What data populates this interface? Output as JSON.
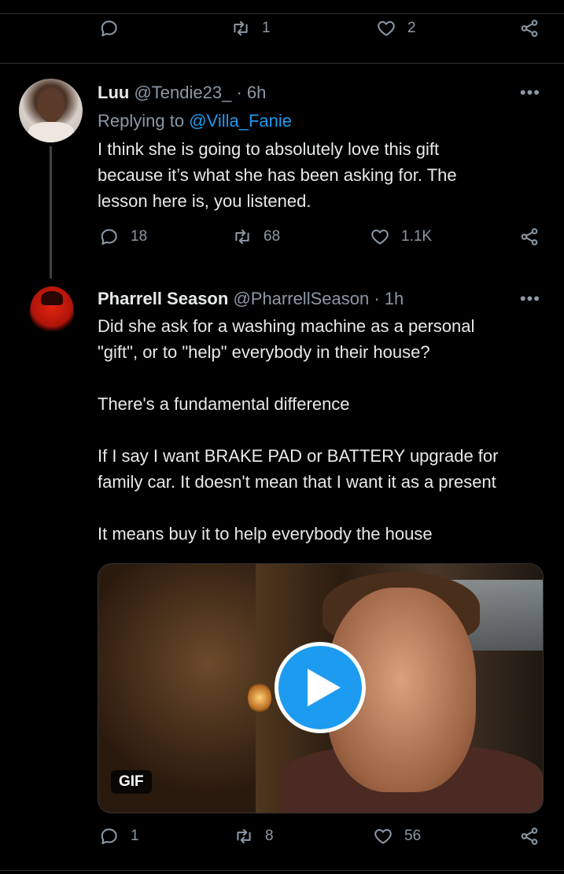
{
  "prev_tweet": {
    "reply_count": "",
    "retweet_count": "1",
    "like_count": "2"
  },
  "tweet1": {
    "name": "Luu",
    "handle": "@Tendie23_",
    "time": "· 6h",
    "replying_prefix": "Replying to",
    "replying_to": "@Villa_Fanie",
    "text": "I think she is going to absolutely love this gift\nbecause it’s what she has been asking for. The\nlesson here is, you listened.",
    "reply_count": "18",
    "retweet_count": "68",
    "like_count": "1.1K",
    "more_label": "•••"
  },
  "tweet2": {
    "name": "Pharrell Season",
    "handle": "@PharrellSeason",
    "time": "· 1h",
    "text": "Did she ask for a washing machine as a personal\n\"gift\", or to \"help\" everybody in their house?\n\nThere's a fundamental difference\n\nIf I say I want BRAKE PAD or BATTERY upgrade for\nfamily car. It doesn't mean that I want it as a present\n\nIt means buy it to help everybody the house",
    "media_badge": "GIF",
    "reply_count": "1",
    "retweet_count": "8",
    "like_count": "56",
    "more_label": "•••"
  },
  "icons": {
    "reply": "reply-icon",
    "retweet": "retweet-icon",
    "like": "heart-icon",
    "share": "share-icon",
    "play": "play-icon"
  },
  "colors": {
    "background": "#000000",
    "accent": "#1d9bf0",
    "muted": "#8b98a5",
    "text": "#e7e9ea"
  }
}
